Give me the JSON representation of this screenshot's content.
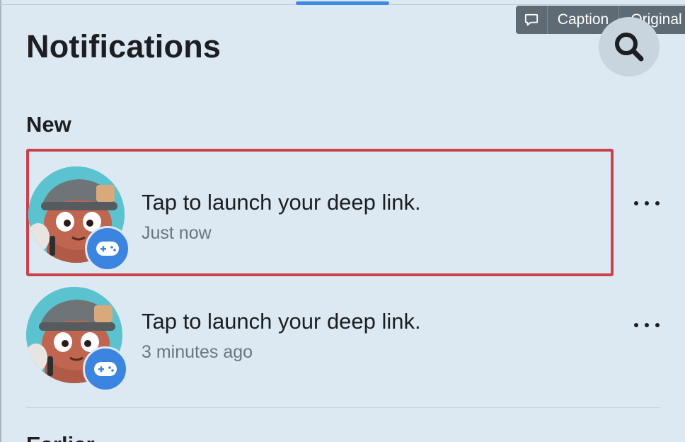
{
  "header": {
    "title": "Notifications"
  },
  "overlay_toolbar": {
    "caption_label": "Caption",
    "original_label": "Original"
  },
  "sections": {
    "new_label": "New",
    "earlier_label": "Earlier"
  },
  "notifications": [
    {
      "message": "Tap to launch your deep link.",
      "time": "Just now",
      "highlighted": true
    },
    {
      "message": "Tap to launch your deep link.",
      "time": "3 minutes ago",
      "highlighted": false
    }
  ],
  "icons": {
    "search": "search-icon",
    "more": "more-horizontal-icon",
    "badge": "gamepad-icon",
    "caption": "speech-bubble-icon"
  },
  "colors": {
    "background": "#dde9f2",
    "highlight_border": "#c9414a",
    "badge": "#3b84e0",
    "tab_indicator": "#3d8ae6"
  }
}
